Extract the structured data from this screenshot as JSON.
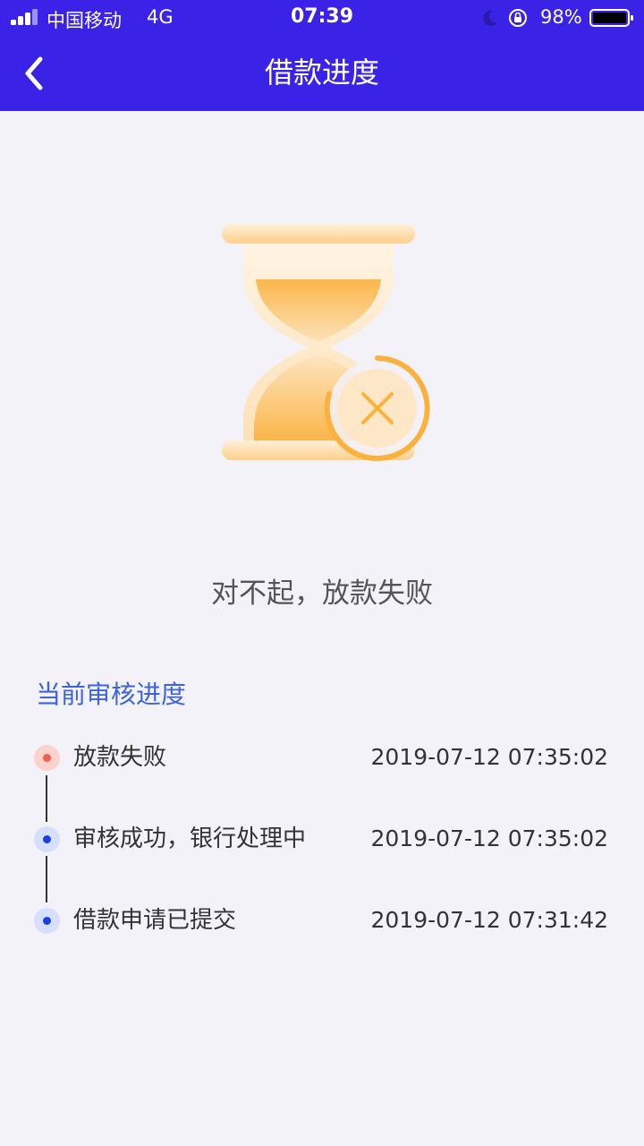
{
  "status_bar": {
    "carrier": "中国移动",
    "network": "4G",
    "time": "07:39",
    "battery": "98%",
    "icons": [
      "signal-icon",
      "moon-icon",
      "orientation-lock-icon",
      "battery-icon"
    ]
  },
  "nav": {
    "title": "借款进度",
    "back_icon": "chevron-left-icon"
  },
  "result": {
    "illustration": "hourglass-failed-icon",
    "message": "对不起，放款失败"
  },
  "progress": {
    "title": "当前审核进度",
    "steps": [
      {
        "label": "放款失败",
        "time": "2019-07-12 07:35:02",
        "status": "failed"
      },
      {
        "label": "审核成功，银行处理中",
        "time": "2019-07-12 07:35:02",
        "status": "done"
      },
      {
        "label": "借款申请已提交",
        "time": "2019-07-12 07:31:42",
        "status": "done"
      }
    ]
  },
  "colors": {
    "header_bg": "#3a22e6",
    "page_bg": "#f3f2f8",
    "accent_blue": "#3d63dd",
    "failed_red": "#f0614d",
    "done_blue": "#1c3fe0",
    "hourglass_orange": "#fbb13c"
  }
}
